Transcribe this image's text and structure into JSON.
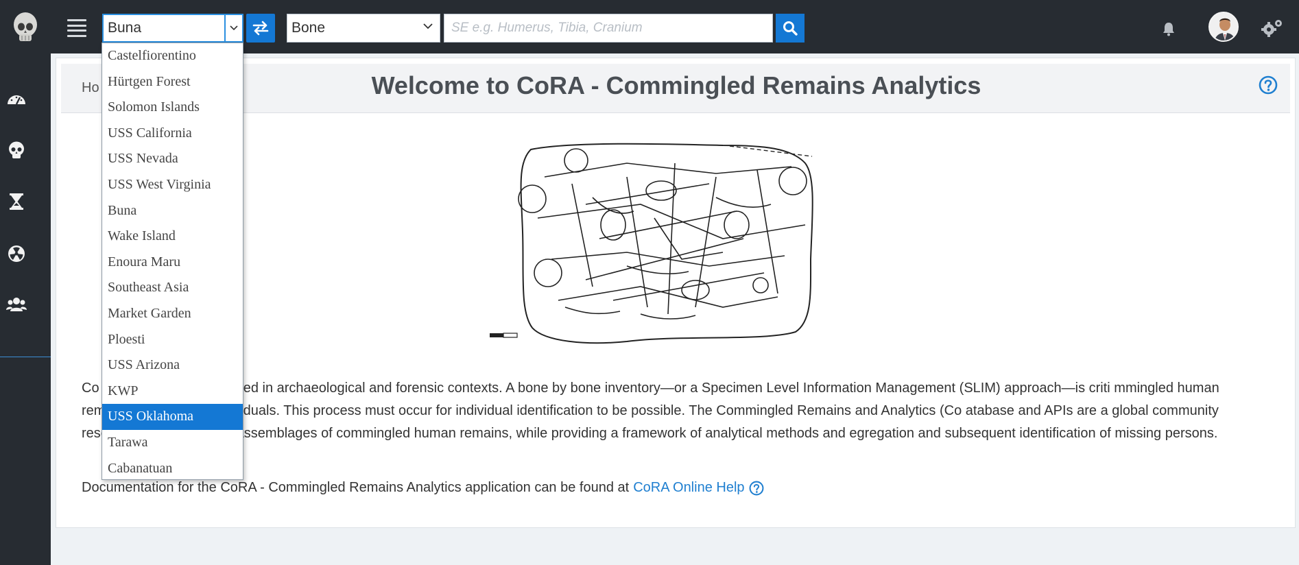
{
  "header": {
    "site_select_value": "Buna",
    "bone_select_value": "Bone",
    "search_placeholder": "SE e.g. Humerus, Tibia, Cranium"
  },
  "site_dropdown": {
    "options": [
      "Castelfiorentino",
      "Hürtgen Forest",
      "Solomon Islands",
      "USS California",
      "USS Nevada",
      "USS West Virginia",
      "Buna",
      "Wake Island",
      "Enoura Maru",
      "Southeast Asia",
      "Market Garden",
      "Ploesti",
      "USS Arizona",
      "KWP",
      "USS Oklahoma",
      "Tarawa",
      "Cabanatuan"
    ],
    "highlighted": "USS Oklahoma"
  },
  "breadcrumb": "Ho",
  "page_title": "Welcome to CoRA - Commingled Remains Analytics",
  "intro_text": "Co                         ins are often encountered in archaeological and forensic contexts. A bone by bone inventory—or a Specimen Level Information Management (SLIM) approach—is criti                       mmingled human remains into discrete individuals. This process must occur for individual identification to be possible. The Commingled Remains and Analytics (Co                       atabase and APIs are a global community resource for inventorying assemblages of commingled human remains, while providing a framework of analytical methods and                       egregation and subsequent identification of missing persons.",
  "documentation": {
    "prefix": "Documentation for the CoRA - Commingled Remains Analytics application can be found at",
    "link_label": "CoRA Online Help"
  },
  "colors": {
    "topbar": "#272c32",
    "accent": "#1478d4",
    "link": "#1f7fd0"
  },
  "icons": {
    "sidebar": [
      "dashboard-icon",
      "skull-icon",
      "hourglass-icon",
      "radiation-icon",
      "users-icon"
    ],
    "topbar": [
      "menu-icon",
      "swap-icon",
      "search-icon",
      "bell-icon",
      "gears-icon"
    ]
  }
}
